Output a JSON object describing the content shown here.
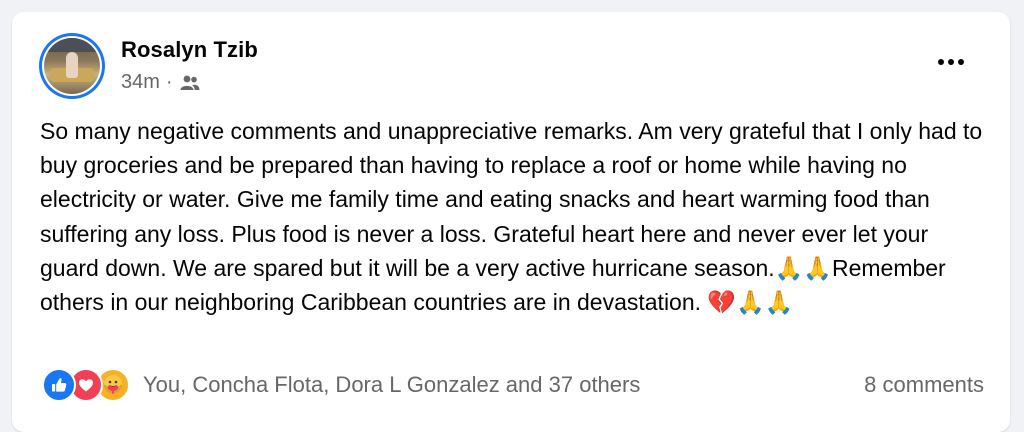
{
  "post": {
    "author": "Rosalyn Tzib",
    "time": "34m",
    "separator": "·",
    "audience_icon": "friends-icon",
    "more_icon": "more-options-icon",
    "text": "So many negative comments and unappreciative remarks. Am very grateful that I only had to buy groceries and be prepared than having to replace a roof or home while having no electricity or water. Give me family time and eating snacks and heart warming food than suffering any loss. Plus food is never a loss. Grateful heart here and never ever let your guard down. We are spared but it will be a very active hurricane season.🙏🙏Remember others in our neighboring Caribbean countries are in devastation. 💔🙏🙏"
  },
  "reactions": {
    "icons": [
      "like-icon",
      "love-icon",
      "care-icon"
    ],
    "summary": "You, Concha Flota, Dora L Gonzalez and 37 others",
    "comments": "8 comments"
  },
  "colors": {
    "like": "#1877f2",
    "love": "#f33e58",
    "care": "#f7b125",
    "secondary_text": "#65676b",
    "avatar_ring": "#1877f2"
  }
}
